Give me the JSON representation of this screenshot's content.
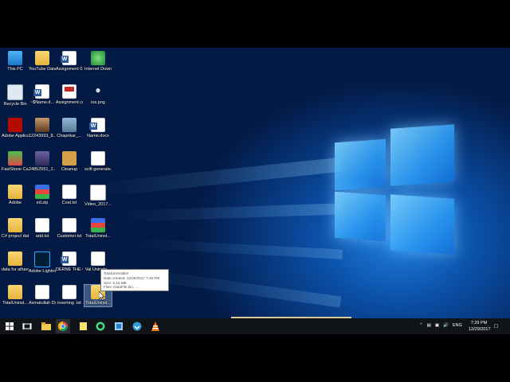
{
  "desktop_icons": [
    {
      "label": "This PC",
      "col": 0,
      "row": 0,
      "kind": "pc"
    },
    {
      "label": "YouTube Data",
      "col": 1,
      "row": 0,
      "kind": "folder"
    },
    {
      "label": "Assignment 02.docx",
      "col": 2,
      "row": 0,
      "kind": "word"
    },
    {
      "label": "Internet Downlo...",
      "col": 3,
      "row": 0,
      "kind": "globe"
    },
    {
      "label": "Recycle Bin",
      "col": 0,
      "row": 1,
      "kind": "bin"
    },
    {
      "label": "~$Name.d...",
      "col": 1,
      "row": 1,
      "kind": "word"
    },
    {
      "label": "Assignment cover.pdf",
      "col": 2,
      "row": 1,
      "kind": "pdf"
    },
    {
      "label": "ios.png",
      "col": 3,
      "row": 1,
      "kind": "apple"
    },
    {
      "label": "Adobe Applicati...",
      "col": 0,
      "row": 2,
      "kind": "adobe"
    },
    {
      "label": "12243993_8...",
      "col": 1,
      "row": 2,
      "kind": "photo"
    },
    {
      "label": "Chaprikar_...",
      "col": 2,
      "row": 2,
      "kind": "image"
    },
    {
      "label": "Name.docx",
      "col": 3,
      "row": 2,
      "kind": "word"
    },
    {
      "label": "FastStone Capture",
      "col": 0,
      "row": 3,
      "kind": "faststone"
    },
    {
      "label": "24852551_1...",
      "col": 1,
      "row": 3,
      "kind": "photo2"
    },
    {
      "label": "Cleanup",
      "col": 2,
      "row": 3,
      "kind": "broom"
    },
    {
      "label": "scift generate.w...",
      "col": 3,
      "row": 3,
      "kind": "doc"
    },
    {
      "label": "Adobe",
      "col": 0,
      "row": 4,
      "kind": "folder"
    },
    {
      "label": "ed.zip",
      "col": 1,
      "row": 4,
      "kind": "zip"
    },
    {
      "label": "Cost.txt",
      "col": 2,
      "row": 4,
      "kind": "doc"
    },
    {
      "label": "Video_2017...",
      "col": 3,
      "row": 4,
      "kind": "video"
    },
    {
      "label": "C# project data",
      "col": 0,
      "row": 5,
      "kind": "folder"
    },
    {
      "label": "add.txt",
      "col": 1,
      "row": 5,
      "kind": "doc"
    },
    {
      "label": "Customer.txt",
      "col": 2,
      "row": 5,
      "kind": "doc"
    },
    {
      "label": "TotalUninst...",
      "col": 3,
      "row": 5,
      "kind": "zip"
    },
    {
      "label": "data for alharo...",
      "col": 0,
      "row": 6,
      "kind": "folder"
    },
    {
      "label": "Adobe Lightroom",
      "col": 1,
      "row": 6,
      "kind": "lightroom"
    },
    {
      "label": "DERNE THE CLOSURES ...",
      "col": 2,
      "row": 6,
      "kind": "word"
    },
    {
      "label": "Val Uninsta...",
      "col": 3,
      "row": 6,
      "kind": "doc"
    },
    {
      "label": "TotalUninst...",
      "col": 0,
      "row": 7,
      "kind": "folder"
    },
    {
      "label": "Asmatullah Data.txt",
      "col": 1,
      "row": 7,
      "kind": "doc"
    },
    {
      "label": "inserting .txt",
      "col": 2,
      "row": 7,
      "kind": "doc"
    },
    {
      "label": "TotalUninst...",
      "col": 3,
      "row": 7,
      "kind": "folder-selected"
    }
  ],
  "tooltip": {
    "name": "TotalUninstaller",
    "date": "Date created: 12/29/2017 7:28 PM",
    "size": "Size: 5.15 MB",
    "files": "Files: DataFile.bin, ..."
  },
  "taskbar": {
    "time": "7:29 PM",
    "date": "12/29/2017",
    "lang": "ENG",
    "apps": [
      "start-icon",
      "task-view-icon",
      "file-explorer-icon",
      "chrome-icon",
      "sticky-notes-icon",
      "android-studio-icon",
      "files-icon",
      "idm-icon",
      "vlc-icon"
    ]
  },
  "colors": {
    "accent": "#0b4fa6",
    "taskbar": "#111418"
  }
}
